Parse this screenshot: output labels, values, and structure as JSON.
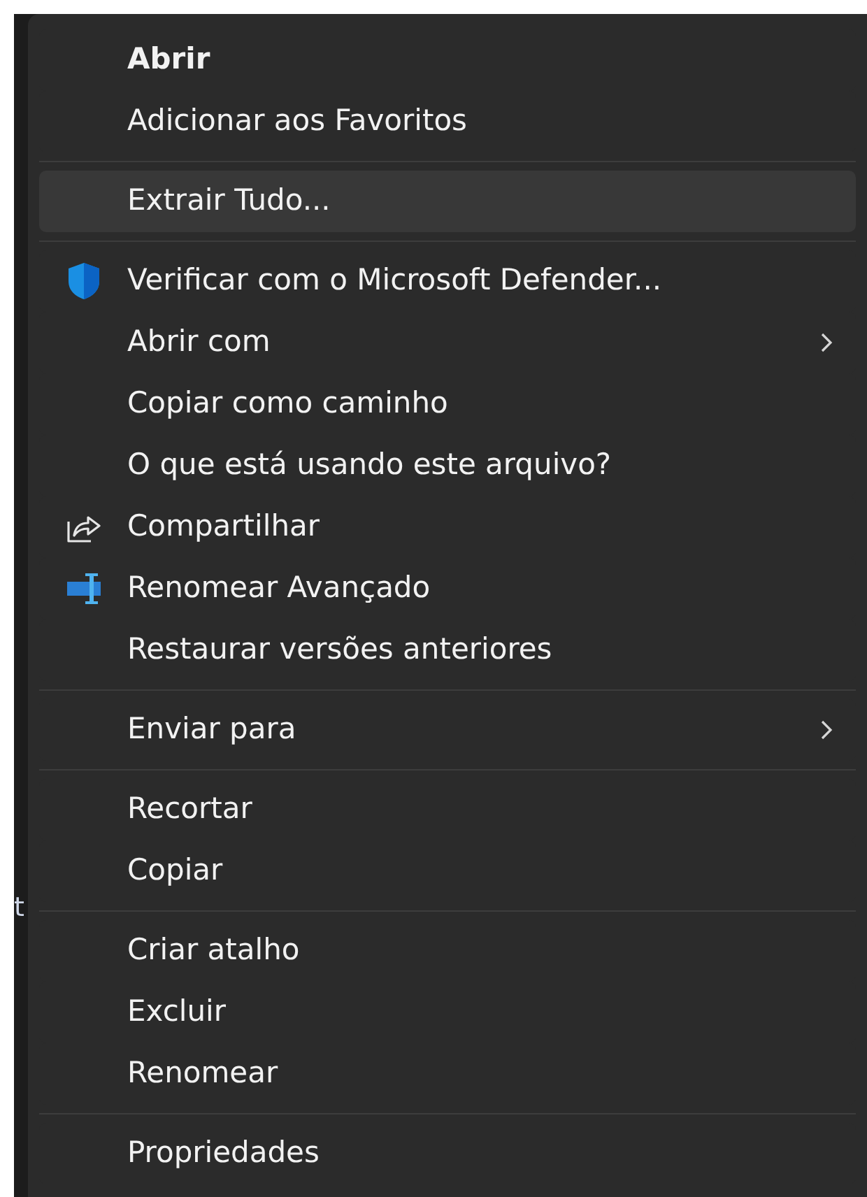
{
  "background_text": "t",
  "menu": {
    "groups": [
      {
        "items": [
          {
            "label": "Abrir",
            "kind": "plain",
            "bold": true,
            "selected": false,
            "submenu": false
          },
          {
            "label": "Adicionar aos Favoritos",
            "kind": "plain",
            "bold": false,
            "selected": false,
            "submenu": false
          }
        ]
      },
      {
        "items": [
          {
            "label": "Extrair Tudo...",
            "kind": "plain",
            "bold": false,
            "selected": true,
            "submenu": false
          }
        ]
      },
      {
        "items": [
          {
            "label": "Verificar com o Microsoft Defender...",
            "kind": "shield",
            "bold": false,
            "selected": false,
            "submenu": false
          },
          {
            "label": "Abrir com",
            "kind": "plain",
            "bold": false,
            "selected": false,
            "submenu": true
          },
          {
            "label": "Copiar como caminho",
            "kind": "plain",
            "bold": false,
            "selected": false,
            "submenu": false
          },
          {
            "label": "O que está usando este arquivo?",
            "kind": "plain",
            "bold": false,
            "selected": false,
            "submenu": false
          },
          {
            "label": "Compartilhar",
            "kind": "share",
            "bold": false,
            "selected": false,
            "submenu": false
          },
          {
            "label": "Renomear Avançado",
            "kind": "rename",
            "bold": false,
            "selected": false,
            "submenu": false
          },
          {
            "label": "Restaurar versões anteriores",
            "kind": "plain",
            "bold": false,
            "selected": false,
            "submenu": false
          }
        ]
      },
      {
        "items": [
          {
            "label": "Enviar para",
            "kind": "plain",
            "bold": false,
            "selected": false,
            "submenu": true
          }
        ]
      },
      {
        "items": [
          {
            "label": "Recortar",
            "kind": "plain",
            "bold": false,
            "selected": false,
            "submenu": false
          },
          {
            "label": "Copiar",
            "kind": "plain",
            "bold": false,
            "selected": false,
            "submenu": false
          }
        ]
      },
      {
        "items": [
          {
            "label": "Criar atalho",
            "kind": "plain",
            "bold": false,
            "selected": false,
            "submenu": false
          },
          {
            "label": "Excluir",
            "kind": "plain",
            "bold": false,
            "selected": false,
            "submenu": false
          },
          {
            "label": "Renomear",
            "kind": "plain",
            "bold": false,
            "selected": false,
            "submenu": false
          }
        ]
      },
      {
        "items": [
          {
            "label": "Propriedades",
            "kind": "plain",
            "bold": false,
            "selected": false,
            "submenu": false
          }
        ]
      }
    ]
  }
}
